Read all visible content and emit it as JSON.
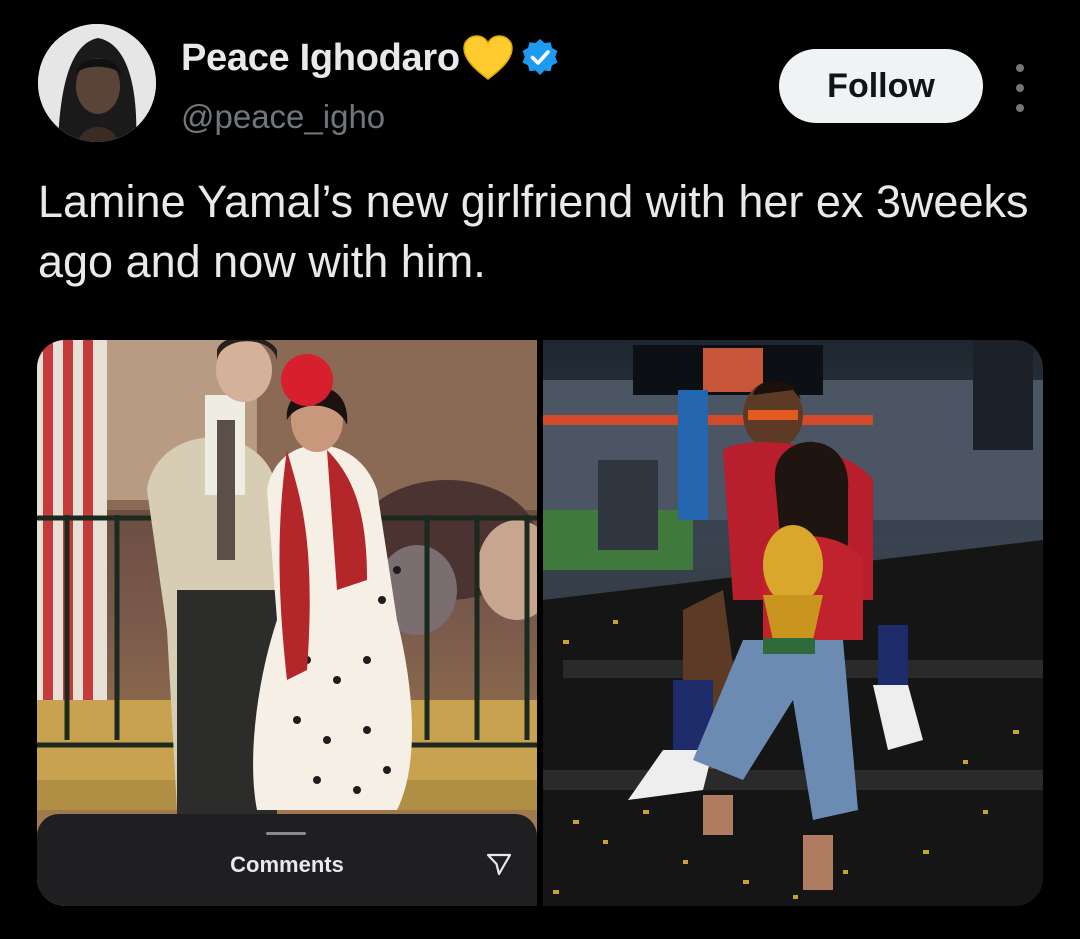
{
  "tweet": {
    "author": {
      "display_name": "Peace Ighodaro",
      "handle": "@peace_igho",
      "verified": true,
      "name_emoji": "yellow-heart-icon"
    },
    "follow_label": "Follow",
    "text": "Lamine Yamal’s new girlfriend with her ex 3weeks ago and now with him.",
    "media": {
      "photos": [
        {
          "icon": "photo-couple-fair"
        },
        {
          "icon": "photo-couple-trophy"
        }
      ],
      "overlay": {
        "comments_label": "Comments",
        "send_icon": "send-icon"
      }
    }
  },
  "colors": {
    "background": "#000000",
    "text_primary": "#e7e9ea",
    "text_secondary": "#71767b",
    "verified_blue": "#1d9bf0",
    "follow_button_bg": "#eff3f4"
  }
}
